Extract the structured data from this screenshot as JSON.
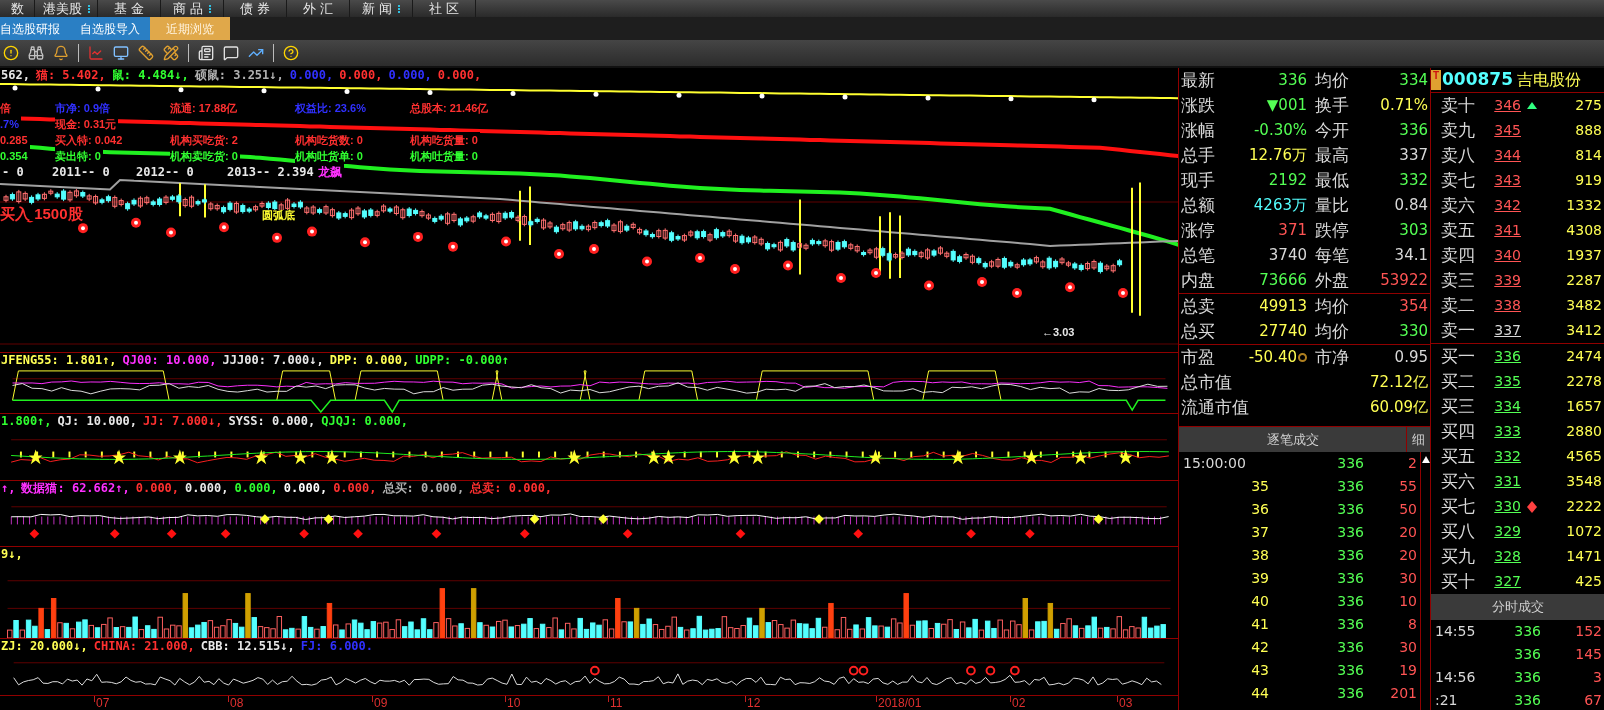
{
  "menu_bar": {
    "items": [
      {
        "label": "数",
        "submenu": false
      },
      {
        "label": "港美股",
        "submenu": true
      },
      {
        "label": "基 金",
        "submenu": false
      },
      {
        "label": "商 品",
        "submenu": true
      },
      {
        "label": "债 券",
        "submenu": false
      },
      {
        "label": "外 汇",
        "submenu": false
      },
      {
        "label": "新 闻",
        "submenu": true
      },
      {
        "label": "社 区",
        "submenu": false
      }
    ]
  },
  "tabs": [
    {
      "label": "自选股研报",
      "selected": false
    },
    {
      "label": "自选股导入",
      "selected": false
    },
    {
      "label": "近期浏览",
      "selected": true
    }
  ],
  "main_chart": {
    "legend": [
      {
        "text": "562,",
        "color": "#e8e8e8"
      },
      {
        "text": "猫: 5.402,",
        "color": "#ff3030"
      },
      {
        "text": "鼠: 4.484↓,",
        "color": "#30ff30"
      },
      {
        "text": "硕鼠: 3.251↓,",
        "color": "#b0b0b0"
      },
      {
        "text": "0.000,",
        "color": "#3030ff"
      },
      {
        "text": "0.000,",
        "color": "#ff3030"
      },
      {
        "text": "0.000,",
        "color": "#3030ff"
      },
      {
        "text": "0.000,",
        "color": "#ff3030"
      }
    ],
    "overlay_rows": [
      [
        {
          "text": "倍",
          "color": "#ff3030"
        },
        {
          "text": "市净: 0.9倍",
          "color": "#3030ff"
        },
        {
          "text": "流通: 17.88亿",
          "color": "#ff3030"
        },
        {
          "text": "权益比: 23.6%",
          "color": "#3030ff"
        },
        {
          "text": "总股本: 21.46亿",
          "color": "#ff3030"
        }
      ],
      [
        {
          "text": ".7%",
          "color": "#3030ff"
        },
        {
          "text": "现金: 0.31元",
          "color": "#ff3030"
        }
      ],
      [
        {
          "text": "0.285",
          "color": "#ff3030"
        },
        {
          "text": "买入特: 0.042",
          "color": "#ff3030"
        },
        {
          "text": "机构买吃货: 2",
          "color": "#ff3030"
        },
        {
          "text": "机构吃货数: 0",
          "color": "#ff3030"
        },
        {
          "text": "机构吃货量: 0",
          "color": "#ff3030"
        }
      ],
      [
        {
          "text": "0.354",
          "color": "#30ff30"
        },
        {
          "text": "卖出特: 0",
          "color": "#30ff30"
        },
        {
          "text": "机构卖吃货: 0",
          "color": "#30ff30"
        },
        {
          "text": "机构吐货单: 0",
          "color": "#30ff30"
        },
        {
          "text": "机构吐货量: 0",
          "color": "#30ff30"
        }
      ]
    ],
    "year_row": [
      {
        "text": "- 0",
        "color": "#e8e8e8"
      },
      {
        "text": "2011-- 0",
        "color": "#e8e8e8"
      },
      {
        "text": "2012-- 0",
        "color": "#e8e8e8"
      },
      {
        "text": "2013-- 2.394",
        "color": "#e8e8e8"
      },
      {
        "text": "龙飙",
        "color": "#ff30ff"
      }
    ],
    "annotations": [
      {
        "text": "买入 1500股",
        "color": "#ff3030"
      },
      {
        "text": "圆弧底",
        "color": "#ffff30"
      },
      {
        "text": "←3.03",
        "color": "#e8e8e8"
      }
    ]
  },
  "indicator_panels": [
    {
      "legend": [
        {
          "text": "JFENG55: 1.801↑,",
          "color": "#ffff54"
        },
        {
          "text": "QJ00: 10.000,",
          "color": "#ff30ff"
        },
        {
          "text": "JJJ00: 7.000↓,",
          "color": "#e8e8e8"
        },
        {
          "text": "DPP: 0.000,",
          "color": "#ffff54"
        },
        {
          "text": "UDPP: -0.000↑",
          "color": "#30ff30"
        }
      ]
    },
    {
      "legend": [
        {
          "text": "1.800↑,",
          "color": "#30ff30"
        },
        {
          "text": "QJ: 10.000,",
          "color": "#e8e8e8"
        },
        {
          "text": "JJ: 7.000↓,",
          "color": "#ff3030"
        },
        {
          "text": "SYSS: 0.000,",
          "color": "#e8e8e8"
        },
        {
          "text": "QJQJ: 0.000,",
          "color": "#30ff30"
        }
      ]
    },
    {
      "legend": [
        {
          "text": "↑,",
          "color": "#ff30ff"
        },
        {
          "text": "数据猫: 62.662↑,",
          "color": "#ff30ff"
        },
        {
          "text": "0.000,",
          "color": "#ff3030"
        },
        {
          "text": "0.000,",
          "color": "#e8e8e8"
        },
        {
          "text": "0.000,",
          "color": "#30ff30"
        },
        {
          "text": "0.000,",
          "color": "#ffffff"
        },
        {
          "text": "0.000,",
          "color": "#ff3030"
        },
        {
          "text": "总买: 0.000,",
          "color": "#b0b0b0"
        },
        {
          "text": "总卖: 0.000,",
          "color": "#ff3030"
        }
      ]
    },
    {
      "legend": [
        {
          "text": "9↓,",
          "color": "#ffff54"
        }
      ]
    },
    {
      "legend": [
        {
          "text": "ZJ: 20.000↓,",
          "color": "#ffff54"
        },
        {
          "text": "CHINA: 21.000,",
          "color": "#ff3030"
        },
        {
          "text": "CBB: 12.515↓,",
          "color": "#e8e8e8"
        },
        {
          "text": "FJ: 6.000.",
          "color": "#3030ff"
        }
      ]
    }
  ],
  "x_axis": {
    "labels": [
      "07",
      "08",
      "09",
      "10",
      "11",
      "12",
      "2018/01",
      "02",
      "03"
    ]
  },
  "quote": {
    "sections": [
      [
        {
          "cells": [
            {
              "label": "最新",
              "value": "336",
              "color": "#54ff54"
            },
            {
              "label": "均价",
              "value": "334",
              "color": "#54ff54"
            }
          ]
        },
        {
          "cells": [
            {
              "label": "涨跌",
              "value": "▼001",
              "color": "#54ff54"
            },
            {
              "label": "换手",
              "value": "0.71%",
              "color": "#ffff54"
            }
          ]
        },
        {
          "cells": [
            {
              "label": "涨幅",
              "value": "-0.30%",
              "color": "#54ff54"
            },
            {
              "label": "今开",
              "value": "336",
              "color": "#54ff54"
            }
          ]
        },
        {
          "cells": [
            {
              "label": "总手",
              "value": "12.76万",
              "color": "#ffff54"
            },
            {
              "label": "最高",
              "value": "337",
              "color": "#d8d8d8"
            }
          ]
        },
        {
          "cells": [
            {
              "label": "现手",
              "value": "2192",
              "color": "#54ff54"
            },
            {
              "label": "最低",
              "value": "332",
              "color": "#54ff54"
            }
          ]
        },
        {
          "cells": [
            {
              "label": "总额",
              "value": "4263万",
              "color": "#54ffff"
            },
            {
              "label": "量比",
              "value": "0.84",
              "color": "#d8d8d8"
            }
          ]
        },
        {
          "cells": [
            {
              "label": "涨停",
              "value": "371",
              "color": "#ff5454"
            },
            {
              "label": "跌停",
              "value": "303",
              "color": "#54ff54"
            }
          ]
        },
        {
          "cells": [
            {
              "label": "总笔",
              "value": "3740",
              "color": "#d8d8d8"
            },
            {
              "label": "每笔",
              "value": "34.1",
              "color": "#d8d8d8"
            }
          ]
        },
        {
          "cells": [
            {
              "label": "内盘",
              "value": "73666",
              "color": "#54ff54"
            },
            {
              "label": "外盘",
              "value": "53922",
              "color": "#ff5454"
            }
          ]
        }
      ],
      [
        {
          "cells": [
            {
              "label": "总卖",
              "value": "49913",
              "color": "#ffff54"
            },
            {
              "label": "均价",
              "value": "354",
              "color": "#ff5454"
            }
          ]
        },
        {
          "cells": [
            {
              "label": "总买",
              "value": "27740",
              "color": "#ffff54"
            },
            {
              "label": "均价",
              "value": "330",
              "color": "#54ff54"
            }
          ]
        }
      ],
      [
        {
          "cells": [
            {
              "label": "市盈",
              "value": "-50.40",
              "color": "#ffff54"
            },
            {
              "label": "市净",
              "value": "0.95",
              "color": "#d8d8d8"
            }
          ]
        },
        {
          "cells": [
            {
              "label": "总市值",
              "value": "72.12亿",
              "color": "#ffff54"
            }
          ]
        },
        {
          "cells": [
            {
              "label": "流通市值",
              "value": "60.09亿",
              "color": "#ffff54"
            }
          ]
        }
      ]
    ]
  },
  "trades": {
    "title": "逐笔成交",
    "detail_button": "细",
    "rows": [
      {
        "time": "15:00:00",
        "price": "336",
        "volume": "2"
      },
      {
        "time": "35",
        "price": "336",
        "volume": "55"
      },
      {
        "time": "36",
        "price": "336",
        "volume": "50"
      },
      {
        "time": "37",
        "price": "336",
        "volume": "20"
      },
      {
        "time": "38",
        "price": "336",
        "volume": "20"
      },
      {
        "time": "39",
        "price": "336",
        "volume": "30"
      },
      {
        "time": "40",
        "price": "336",
        "volume": "10"
      },
      {
        "time": "41",
        "price": "336",
        "volume": "8"
      },
      {
        "time": "42",
        "price": "336",
        "volume": "30"
      },
      {
        "time": "43",
        "price": "336",
        "volume": "19"
      },
      {
        "time": "44",
        "price": "336",
        "volume": "201"
      }
    ]
  },
  "order_book": {
    "badge": "T",
    "code": "000875",
    "name": "吉电股份",
    "asks": [
      {
        "kind": "up",
        "label": "卖十",
        "price": "346",
        "color": "#ff5454",
        "volume": "275"
      },
      {
        "kind": "plain",
        "label": "卖九",
        "price": "345",
        "color": "#ff5454",
        "volume": "888"
      },
      {
        "kind": "plain",
        "label": "卖八",
        "price": "344",
        "color": "#ff5454",
        "volume": "814"
      },
      {
        "kind": "plain",
        "label": "卖七",
        "price": "343",
        "color": "#ff5454",
        "volume": "919"
      },
      {
        "kind": "plain",
        "label": "卖六",
        "price": "342",
        "color": "#ff5454",
        "volume": "1332"
      },
      {
        "kind": "plain",
        "label": "卖五",
        "price": "341",
        "color": "#ff5454",
        "volume": "4308"
      },
      {
        "kind": "plain",
        "label": "卖四",
        "price": "340",
        "color": "#ff5454",
        "volume": "1937"
      },
      {
        "kind": "plain",
        "label": "卖三",
        "price": "339",
        "color": "#ff5454",
        "volume": "2287"
      },
      {
        "kind": "plain",
        "label": "卖二",
        "price": "338",
        "color": "#ff5454",
        "volume": "3482"
      },
      {
        "kind": "plain",
        "label": "卖一",
        "price": "337",
        "color": "#d8d8d8",
        "volume": "3412"
      }
    ],
    "bids": [
      {
        "kind": "plain",
        "label": "买一",
        "price": "336",
        "color": "#54ff54",
        "volume": "2474"
      },
      {
        "kind": "plain",
        "label": "买二",
        "price": "335",
        "color": "#54ff54",
        "volume": "2278"
      },
      {
        "kind": "plain",
        "label": "买三",
        "price": "334",
        "color": "#54ff54",
        "volume": "1657"
      },
      {
        "kind": "plain",
        "label": "买四",
        "price": "333",
        "color": "#54ff54",
        "volume": "2880"
      },
      {
        "kind": "plain",
        "label": "买五",
        "price": "332",
        "color": "#54ff54",
        "volume": "4565"
      },
      {
        "kind": "plain",
        "label": "买六",
        "price": "331",
        "color": "#54ff54",
        "volume": "3548"
      },
      {
        "kind": "updown",
        "label": "买七",
        "price": "330",
        "color": "#54ff54",
        "volume": "2222"
      },
      {
        "kind": "plain",
        "label": "买八",
        "price": "329",
        "color": "#54ff54",
        "volume": "1072"
      },
      {
        "kind": "plain",
        "label": "买九",
        "price": "328",
        "color": "#54ff54",
        "volume": "1471"
      },
      {
        "kind": "plain",
        "label": "买十",
        "price": "327",
        "color": "#54ff54",
        "volume": "425"
      }
    ]
  },
  "time_sales": {
    "title": "分时成交",
    "rows": [
      {
        "time": "14:55",
        "price": "336",
        "volume": "152"
      },
      {
        "price": "336",
        "volume": "145"
      },
      {
        "time": "14:56",
        "price": "336",
        "volume": "3"
      },
      {
        "time": ":21",
        "price": "336",
        "volume": "67"
      }
    ]
  }
}
